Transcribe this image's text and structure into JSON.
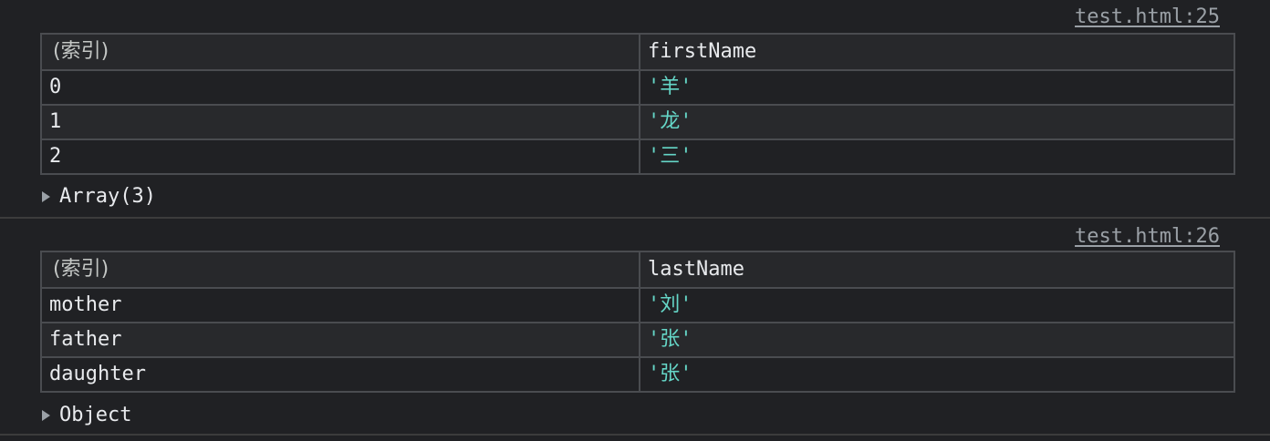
{
  "messages": [
    {
      "source": "test.html:25",
      "columns": [
        "(索引)",
        "firstName"
      ],
      "rows": [
        {
          "index": "0",
          "value": "'羊'"
        },
        {
          "index": "1",
          "value": "'龙'"
        },
        {
          "index": "2",
          "value": "'三'"
        }
      ],
      "summary": "Array(3)"
    },
    {
      "source": "test.html:26",
      "columns": [
        "(索引)",
        "lastName"
      ],
      "rows": [
        {
          "index": "mother",
          "value": "'刘'"
        },
        {
          "index": "father",
          "value": "'张'"
        },
        {
          "index": "daughter",
          "value": "'张'"
        }
      ],
      "summary": "Object"
    }
  ],
  "colors": {
    "background": "#202124",
    "string_value": "#65d6c7",
    "border": "#4a4c50",
    "link": "#9aa0a6"
  }
}
